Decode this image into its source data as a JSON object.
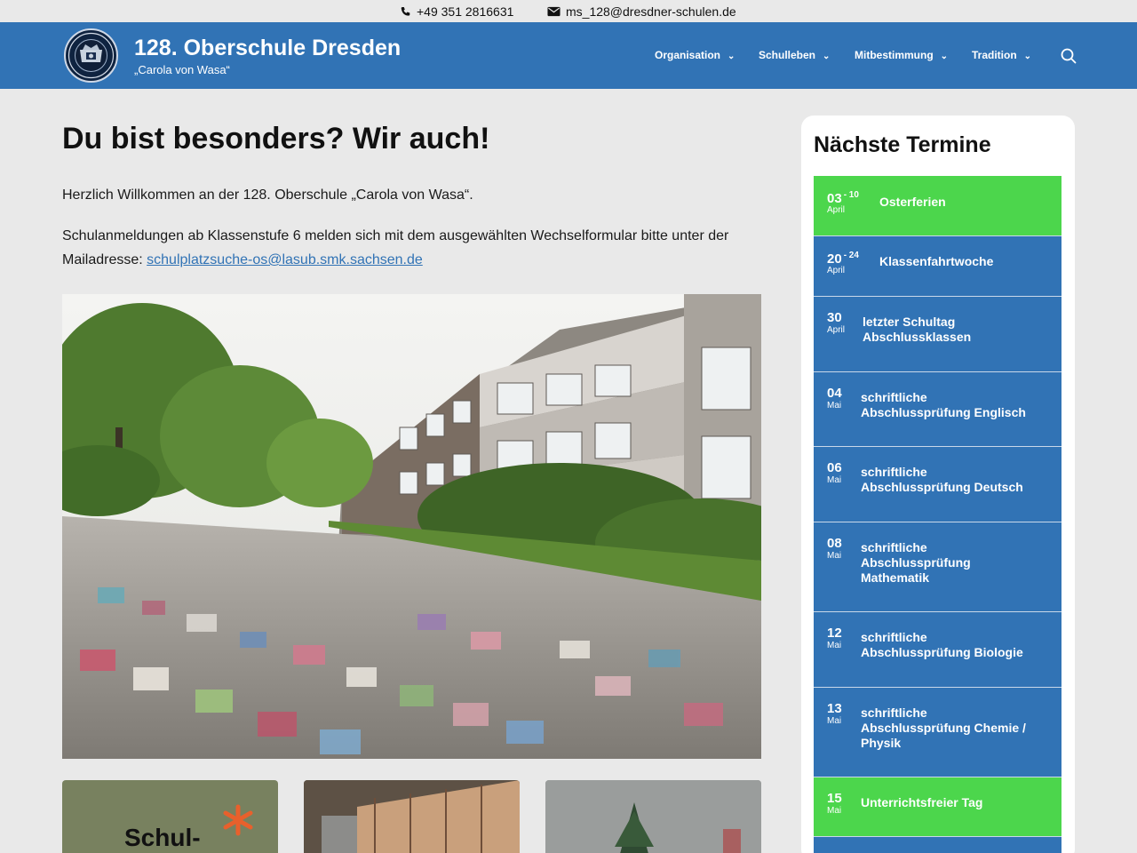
{
  "contact": {
    "phone": "+49 351 2816631",
    "email": "ms_128@dresdner-schulen.de"
  },
  "site": {
    "title": "128. Oberschule Dresden",
    "tagline": "„Carola von Wasa“"
  },
  "nav": {
    "items": [
      {
        "label": "Organisation"
      },
      {
        "label": "Schulleben"
      },
      {
        "label": "Mitbestimmung"
      },
      {
        "label": "Tradition"
      }
    ]
  },
  "main": {
    "title": "Du bist besonders? Wir auch!",
    "welcome": "Herzlich Willkommen an der 128. Oberschule „Carola von Wasa“.",
    "registration_text": "Schulanmeldungen ab Klassenstufe 6 melden sich mit dem ausgewählten Wechselformular bitte unter der Mailadresse: ",
    "registration_email": "schulplatzsuche-os@lasub.smk.sachsen.de",
    "card1_text": "Schul-"
  },
  "sidebar": {
    "title": "Nächste Termine",
    "events": [
      {
        "day": "03",
        "end": "- 10",
        "month": "April",
        "title": "Osterferien",
        "color": "#4cd64c"
      },
      {
        "day": "20",
        "end": "- 24",
        "month": "April",
        "title": "Klassenfahrtwoche",
        "color": "#3173b5"
      },
      {
        "day": "30",
        "end": "",
        "month": "April",
        "title": "letzter Schultag Abschlussklassen",
        "color": "#3173b5"
      },
      {
        "day": "04",
        "end": "",
        "month": "Mai",
        "title": "schriftliche Abschlussprüfung Englisch",
        "color": "#3173b5"
      },
      {
        "day": "06",
        "end": "",
        "month": "Mai",
        "title": "schriftliche Abschlussprüfung Deutsch",
        "color": "#3173b5"
      },
      {
        "day": "08",
        "end": "",
        "month": "Mai",
        "title": "schriftliche Abschlussprüfung Mathematik",
        "color": "#3173b5"
      },
      {
        "day": "12",
        "end": "",
        "month": "Mai",
        "title": "schriftliche Abschlussprüfung Biologie",
        "color": "#3173b5"
      },
      {
        "day": "13",
        "end": "",
        "month": "Mai",
        "title": "schriftliche Abschlussprüfung Chemie / Physik",
        "color": "#3173b5"
      },
      {
        "day": "15",
        "end": "",
        "month": "Mai",
        "title": "Unterrichtsfreier Tag",
        "color": "#4cd64c"
      }
    ]
  },
  "icons": {
    "phone": "phone-icon",
    "mail": "envelope-icon",
    "search": "search-icon",
    "chevron": "chevron-down-icon"
  }
}
